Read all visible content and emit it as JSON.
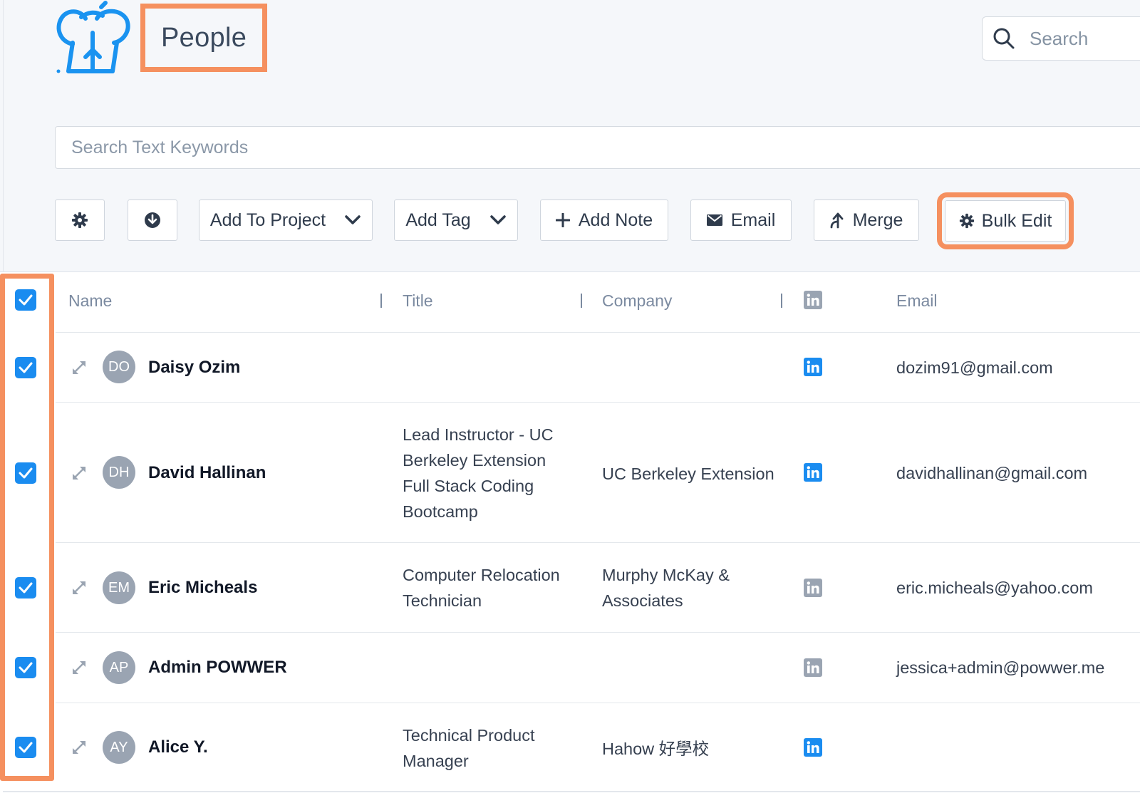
{
  "header": {
    "title": "People",
    "search_placeholder": "Search"
  },
  "keyword_search": {
    "placeholder": "Search Text Keywords"
  },
  "toolbar": {
    "settings_icon": "gear-icon",
    "download_icon": "download-icon",
    "add_to_project": "Add To Project",
    "add_tag": "Add Tag",
    "add_note": "Add Note",
    "email": "Email",
    "merge": "Merge",
    "bulk_edit": "Bulk Edit"
  },
  "table": {
    "columns": {
      "name": "Name",
      "title": "Title",
      "company": "Company",
      "linkedin": "linkedin-icon",
      "email": "Email"
    },
    "rows": [
      {
        "initials": "DO",
        "name": "Daisy Ozim",
        "title": "",
        "company": "",
        "linkedin_active": true,
        "email": "dozim91@gmail.com",
        "checked": true
      },
      {
        "initials": "DH",
        "name": "David Hallinan",
        "title": "Lead Instructor - UC Berkeley Extension Full Stack Coding Bootcamp",
        "company": "UC Berkeley Extension",
        "linkedin_active": true,
        "email": "davidhallinan@gmail.com",
        "checked": true
      },
      {
        "initials": "EM",
        "name": "Eric Micheals",
        "title": "Computer Relocation Technician",
        "company": "Murphy McKay & Associates",
        "linkedin_active": false,
        "email": "eric.micheals@yahoo.com",
        "checked": true
      },
      {
        "initials": "AP",
        "name": "Admin POWWER",
        "title": "",
        "company": "",
        "linkedin_active": false,
        "email": "jessica+admin@powwer.me",
        "checked": true
      },
      {
        "initials": "AY",
        "name": "Alice Y.",
        "title": "Technical Product Manager",
        "company": "Hahow 好學校",
        "linkedin_active": true,
        "email": "",
        "checked": true
      }
    ]
  },
  "colors": {
    "accent": "#1a8cf0",
    "highlight": "#f5905f",
    "linkedin_inactive": "#9aa4b2"
  }
}
